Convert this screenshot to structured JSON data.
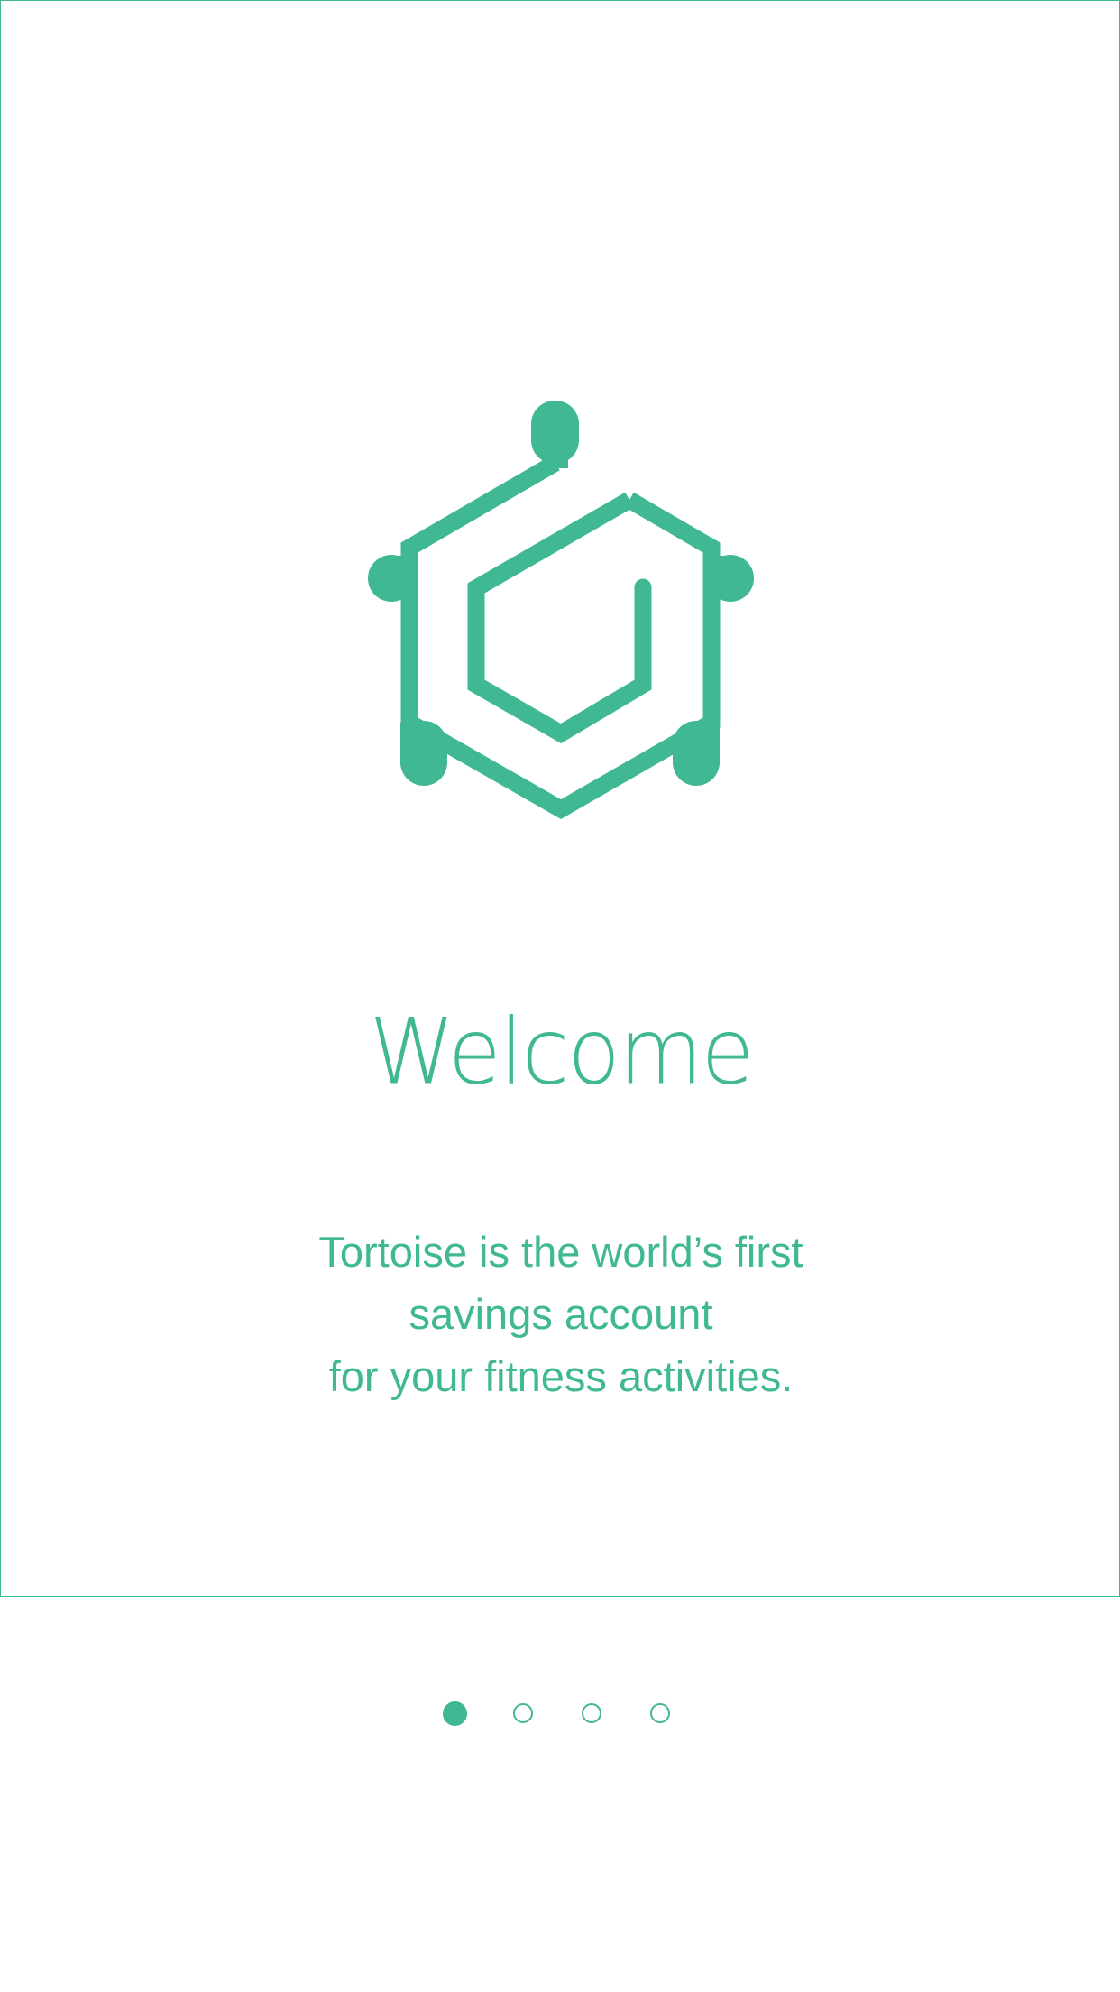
{
  "onboarding": {
    "title": "Welcome",
    "tagline_lines": [
      "Tortoise is the world’s first",
      "savings account",
      "for your fitness activities."
    ]
  },
  "pager": {
    "page_count": 4,
    "current_page": 1
  },
  "colors": {
    "accent": "#3fb893",
    "background": "#ffffff"
  },
  "icons": {
    "logo": "tortoise-hexagon-logo-icon"
  }
}
